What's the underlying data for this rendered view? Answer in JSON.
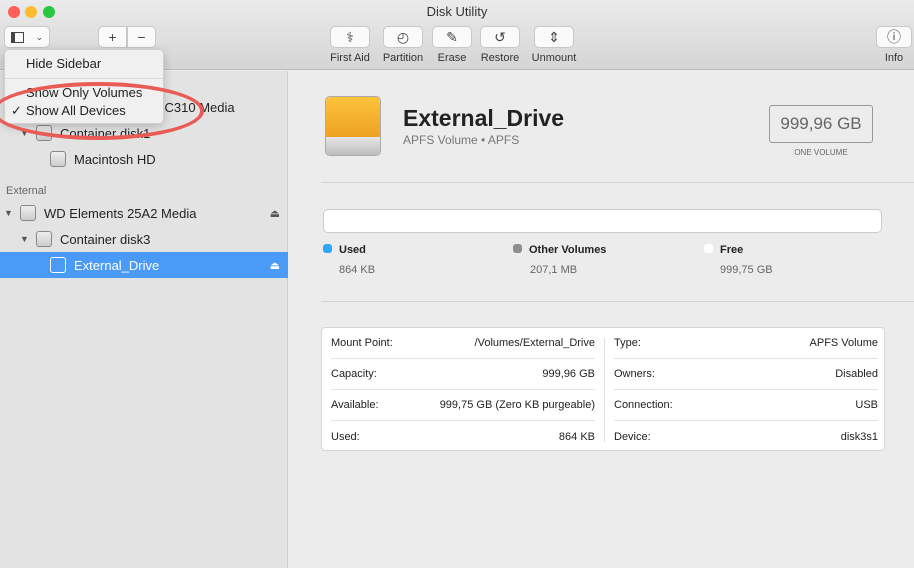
{
  "window": {
    "title": "Disk Utility"
  },
  "colors": {
    "close": "#fe5f57",
    "minimize": "#febc2e",
    "zoom": "#28c840",
    "selection": "#4a9af8",
    "used": "#2ea8f3",
    "other": "#8e8e8e",
    "free": "#ffffff",
    "highlight_oval": "#e95b55"
  },
  "toolbar": {
    "add": "+",
    "remove": "−",
    "buttons": [
      {
        "label": "First Aid",
        "icon": "stethoscope-icon",
        "glyph": "⚕"
      },
      {
        "label": "Partition",
        "icon": "pie-icon",
        "glyph": "◴"
      },
      {
        "label": "Erase",
        "icon": "erase-icon",
        "glyph": "✎"
      },
      {
        "label": "Restore",
        "icon": "restore-icon",
        "glyph": "↺"
      },
      {
        "label": "Unmount",
        "icon": "unmount-icon",
        "glyph": "⇕"
      }
    ],
    "info": {
      "label": "Info",
      "glyph": "ⓘ"
    }
  },
  "menu": {
    "items": [
      {
        "label": "Hide Sidebar"
      },
      {
        "label": "Show Only Volumes"
      },
      {
        "label": "Show All Devices",
        "checked": true,
        "check": "✓"
      }
    ]
  },
  "sidebar": {
    "hidden_row": "JC310 Media",
    "container1": "Container disk1",
    "macintosh": "Macintosh HD",
    "external_header": "External",
    "wd": "WD Elements 25A2 Media",
    "container3": "Container disk3",
    "external_drive": "External_Drive",
    "triangle": "▼",
    "eject": "⏏"
  },
  "volume": {
    "name": "External_Drive",
    "subtitle": "APFS Volume • APFS",
    "size": "999,96 GB",
    "size_caption": "ONE VOLUME"
  },
  "usage": {
    "used": {
      "label": "Used",
      "value": "864 KB"
    },
    "other": {
      "label": "Other Volumes",
      "value": "207,1 MB"
    },
    "free": {
      "label": "Free",
      "value": "999,75 GB"
    }
  },
  "details": {
    "left": [
      {
        "k": "Mount Point:",
        "v": "/Volumes/External_Drive"
      },
      {
        "k": "Capacity:",
        "v": "999,96 GB"
      },
      {
        "k": "Available:",
        "v": "999,75 GB (Zero KB purgeable)"
      },
      {
        "k": "Used:",
        "v": "864 KB"
      }
    ],
    "right": [
      {
        "k": "Type:",
        "v": "APFS Volume"
      },
      {
        "k": "Owners:",
        "v": "Disabled"
      },
      {
        "k": "Connection:",
        "v": "USB"
      },
      {
        "k": "Device:",
        "v": "disk3s1"
      }
    ]
  }
}
